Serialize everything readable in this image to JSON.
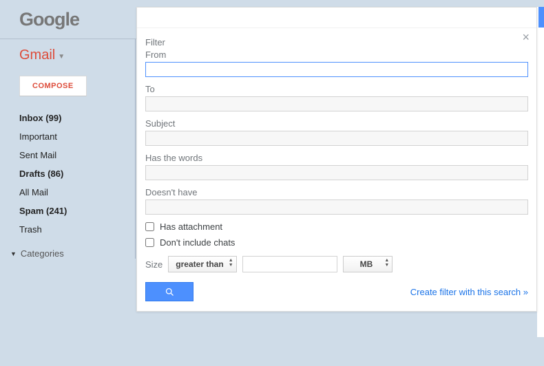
{
  "header": {
    "logo": "Google"
  },
  "sidebar": {
    "app_label": "Gmail",
    "compose": "COMPOSE",
    "items": [
      {
        "label": "Inbox (99)",
        "bold": true
      },
      {
        "label": "Important",
        "bold": false
      },
      {
        "label": "Sent Mail",
        "bold": false
      },
      {
        "label": "Drafts (86)",
        "bold": true
      },
      {
        "label": "All Mail",
        "bold": false
      },
      {
        "label": "Spam (241)",
        "bold": true
      },
      {
        "label": "Trash",
        "bold": false
      }
    ],
    "categories": "Categories"
  },
  "filter": {
    "title": "Filter",
    "fields": {
      "from": "From",
      "to": "To",
      "subject": "Subject",
      "has_words": "Has the words",
      "doesnt_have": "Doesn't have"
    },
    "has_attachment": "Has attachment",
    "dont_include_chats": "Don't include chats",
    "size_label": "Size",
    "size_operator": "greater than",
    "size_unit": "MB",
    "create_link": "Create filter with this search »"
  }
}
